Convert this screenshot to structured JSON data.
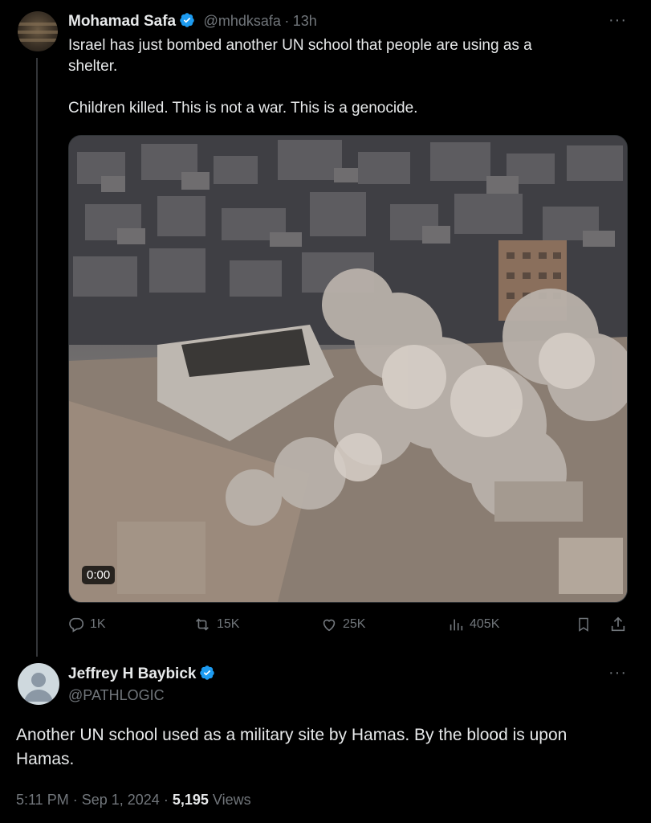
{
  "tweet": {
    "author_name": "Mohamad Safa",
    "handle": "@mhdksafa",
    "separator": "·",
    "time": "13h",
    "text": "Israel has just bombed another UN school that people are using as a\nshelter.\n\nChildren killed. This is not a war. This is a genocide.",
    "video_time": "0:00",
    "actions": {
      "replies": "1K",
      "reposts": "15K",
      "likes": "25K",
      "views": "405K"
    },
    "more": "···"
  },
  "reply": {
    "author_name": "Jeffrey H Baybick",
    "handle": "@PATHLOGIC",
    "text": "Another UN school used as a military site by Hamas.  By the blood is upon Hamas.",
    "time": "5:11 PM",
    "date": "Sep 1, 2024",
    "separator": "·",
    "views_count": "5,195",
    "views_label": "Views",
    "more": "···"
  },
  "colors": {
    "background": "#000000",
    "text": "#e7e9ea",
    "secondary": "#71767b",
    "verified": "#1d9bf0"
  },
  "icons": [
    "verified-badge-icon",
    "reply-icon",
    "repost-icon",
    "like-icon",
    "views-icon",
    "bookmark-icon",
    "share-icon",
    "more-icon",
    "default-avatar-icon"
  ]
}
